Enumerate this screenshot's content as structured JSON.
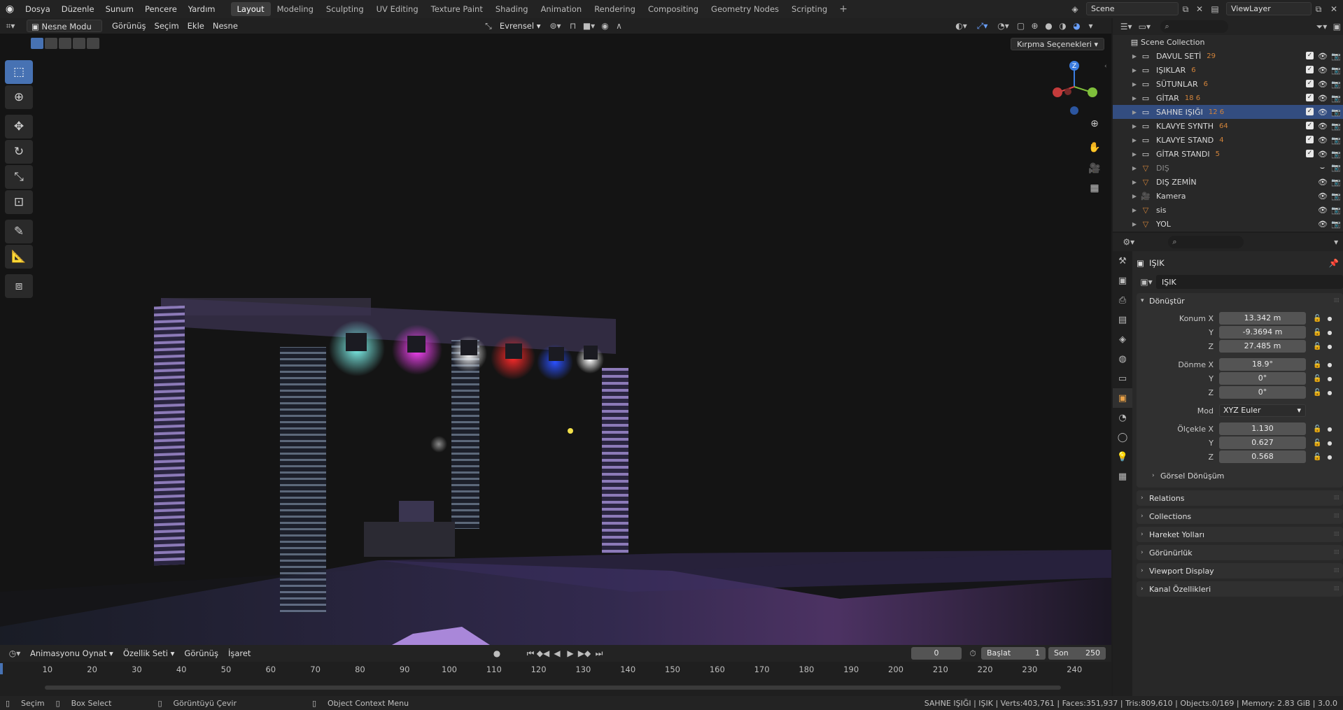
{
  "topbar": {
    "menus": [
      "Dosya",
      "Düzenle",
      "Sunum",
      "Pencere",
      "Yardım"
    ],
    "workspaces": [
      "Layout",
      "Modeling",
      "Sculpting",
      "UV Editing",
      "Texture Paint",
      "Shading",
      "Animation",
      "Rendering",
      "Compositing",
      "Geometry Nodes",
      "Scripting"
    ],
    "active_workspace": "Layout",
    "plus": "+",
    "scene": "Scene",
    "view_layer": "ViewLayer"
  },
  "viewport": {
    "mode": "Nesne Modu",
    "menus": [
      "Görünüş",
      "Seçim",
      "Ekle",
      "Nesne"
    ],
    "orientation": "Evrensel",
    "clipping_options": "Kırpma Seçenekleri",
    "gizmo_axis_z": "Z"
  },
  "outliner": {
    "search_placeholder": "",
    "root": "Scene Collection",
    "items": [
      {
        "name": "DAVUL SETİ",
        "extra": "29",
        "type": "collection"
      },
      {
        "name": "IŞIKLAR",
        "extra": "6",
        "type": "collection"
      },
      {
        "name": "SÜTUNLAR",
        "extra": "6",
        "type": "collection"
      },
      {
        "name": "GİTAR",
        "extra": "18 6",
        "type": "collection"
      },
      {
        "name": "SAHNE IŞIĞI",
        "extra": "12 6",
        "type": "collection",
        "selected": true
      },
      {
        "name": "KLAVYE SYNTH",
        "extra": "64",
        "type": "collection"
      },
      {
        "name": "KLAVYE STAND",
        "extra": "4",
        "type": "collection"
      },
      {
        "name": "GİTAR STANDI",
        "extra": "5",
        "type": "collection"
      },
      {
        "name": "DIŞ",
        "extra": "",
        "type": "mesh",
        "dim": true
      },
      {
        "name": "DIŞ ZEMİN",
        "extra": "",
        "type": "mesh"
      },
      {
        "name": "Kamera",
        "extra": "",
        "type": "camera"
      },
      {
        "name": "sis",
        "extra": "",
        "type": "mesh"
      },
      {
        "name": "YOL",
        "extra": "",
        "type": "mesh"
      }
    ]
  },
  "properties": {
    "object_title": "IŞIK",
    "object_name": "IŞIK",
    "transform_header": "Dönüştür",
    "location": {
      "label_x": "Konum X",
      "label_y": "Y",
      "label_z": "Z",
      "x": "13.342 m",
      "y": "-9.3694 m",
      "z": "27.485 m"
    },
    "rotation": {
      "label_x": "Dönme X",
      "label_y": "Y",
      "label_z": "Z",
      "x": "18.9°",
      "y": "0°",
      "z": "0°"
    },
    "mode": {
      "label": "Mod",
      "value": "XYZ Euler"
    },
    "scale": {
      "label_x": "Ölçekle X",
      "label_y": "Y",
      "label_z": "Z",
      "x": "1.130",
      "y": "0.627",
      "z": "0.568"
    },
    "delta": "Görsel Dönüşüm",
    "panels": [
      "Relations",
      "Collections",
      "Hareket Yolları",
      "Görünürlük",
      "Viewport Display",
      "Kanal Özellikleri"
    ]
  },
  "timeline": {
    "menus": [
      "Animasyonu Oynat",
      "Özellik Seti",
      "Görünüş",
      "İşaret"
    ],
    "current_frame": "0",
    "start_label": "Başlat",
    "start": "1",
    "end_label": "Son",
    "end": "250",
    "ticks": [
      "10",
      "20",
      "30",
      "40",
      "50",
      "60",
      "70",
      "80",
      "90",
      "100",
      "110",
      "120",
      "130",
      "140",
      "150",
      "160",
      "170",
      "180",
      "190",
      "200",
      "210",
      "220",
      "230",
      "240"
    ]
  },
  "status": {
    "select": "Seçim",
    "box_select": "Box Select",
    "rotate_view": "Görüntüyü Çevir",
    "context_menu": "Object Context Menu",
    "stats": "SAHNE IŞIĞI | IŞIK | Verts:403,761 | Faces:351,937 | Tris:809,610 | Objects:0/169 | Memory: 2.83 GiB | 3.0.0"
  }
}
